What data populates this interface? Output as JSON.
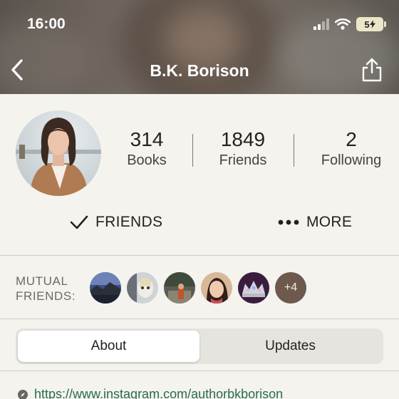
{
  "status_bar": {
    "time": "16:00",
    "battery": "5"
  },
  "header": {
    "title": "B.K. Borison"
  },
  "stats": [
    {
      "value": "314",
      "label": "Books"
    },
    {
      "value": "1849",
      "label": "Friends"
    },
    {
      "value": "2",
      "label": "Following"
    }
  ],
  "actions": {
    "friends_label": "FRIENDS",
    "more_label": "MORE"
  },
  "mutual": {
    "label_line1": "MUTUAL",
    "label_line2": "FRIENDS:",
    "extra_count": "+4"
  },
  "tabs": [
    {
      "label": "About",
      "active": true
    },
    {
      "label": "Updates",
      "active": false
    }
  ],
  "about": {
    "link": "https://www.instagram.com/authorbkborison"
  },
  "colors": {
    "link": "#2a6b4f",
    "background": "#f4f3ee",
    "plus_badge": "#6d5a4c"
  }
}
